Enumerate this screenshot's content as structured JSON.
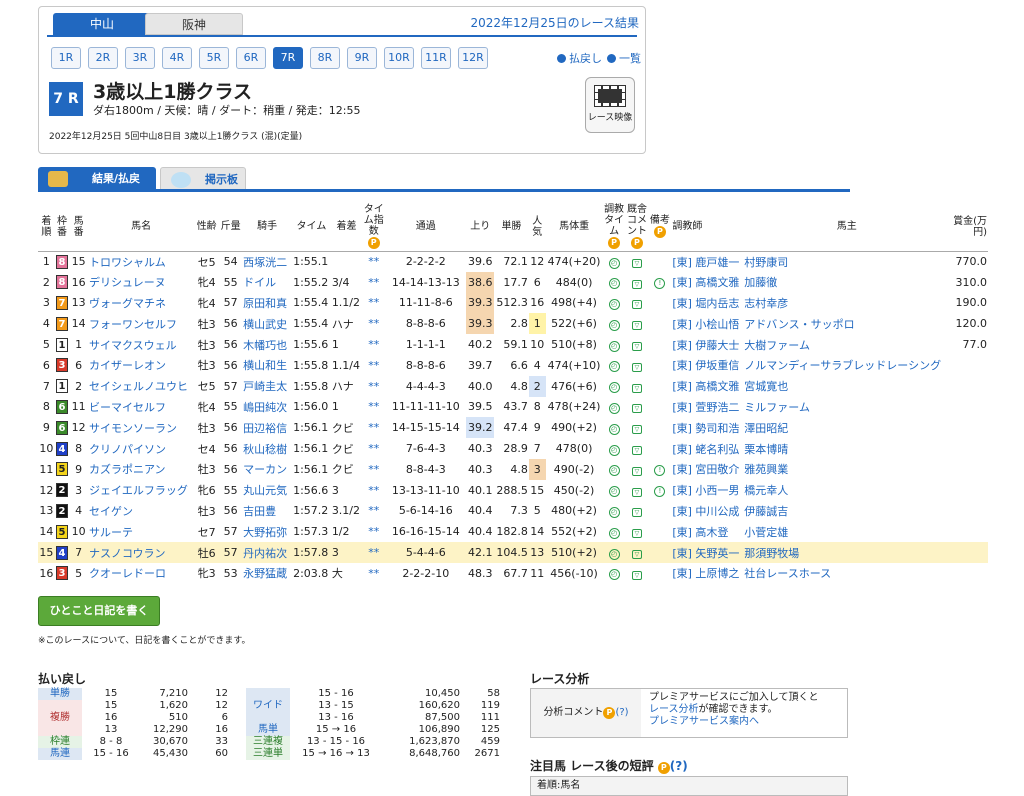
{
  "venue_tabs": [
    {
      "label": "中山",
      "active": true
    },
    {
      "label": "阪神",
      "active": false
    }
  ],
  "results_date_title": "2022年12月25日のレース結果",
  "race_buttons": [
    "1R",
    "2R",
    "3R",
    "4R",
    "5R",
    "6R",
    "7R",
    "8R",
    "9R",
    "10R",
    "11R",
    "12R"
  ],
  "active_race": "7R",
  "links": {
    "payback": "払戻し",
    "list": "一覧"
  },
  "race": {
    "number": "7 R",
    "title": "3歳以上1勝クラス",
    "conditions": "ダ右1800m / 天候：晴 / ダート：稍重 / 発走：12:55",
    "footer": "2022年12月25日 5回中山8日目 3歳以上1勝クラス (混)(定量)",
    "video": "レース映像"
  },
  "tabs": {
    "results": "結果/払戻",
    "board": "掲示板"
  },
  "headers": {
    "rank": "着順",
    "frame": "枠番",
    "num": "馬番",
    "name": "馬名",
    "sexage": "性齢",
    "weight": "斤量",
    "jockey": "騎手",
    "time": "タイム",
    "margin": "着差",
    "index": "タイム指数",
    "passing": "通過",
    "last3f": "上り",
    "odds": "単勝",
    "pop": "人気",
    "body": "馬体重",
    "train_time": "調教タイム",
    "stable_comment": "厩舎コメント",
    "remark": "備考",
    "trainer": "調教師",
    "owner": "馬主",
    "prize": "賞金(万円)"
  },
  "rows": [
    {
      "rank": "1",
      "frame": "8",
      "num": "15",
      "name": "トロワシャルム",
      "sexage": "セ5",
      "weight": "54",
      "jockey": "西塚洸二",
      "time": "1:55.1",
      "margin": "",
      "index": "**",
      "passing": "2-2-2-2",
      "last3f": "39.6",
      "odds": "72.1",
      "pop": "12",
      "body": "474(+20)",
      "remark": "",
      "trainer": "[東] 鹿戸雄一",
      "owner": "村野康司",
      "prize": "770.0"
    },
    {
      "rank": "2",
      "frame": "8",
      "num": "16",
      "name": "デリシュレーヌ",
      "sexage": "牝4",
      "weight": "55",
      "jockey": "ドイル",
      "time": "1:55.2",
      "margin": "3/4",
      "index": "**",
      "passing": "14-14-13-13",
      "last3f": "38.6",
      "odds": "17.7",
      "pop": "6",
      "body": "484(0)",
      "remark": "!",
      "trainer": "[東] 高橋文雅",
      "owner": "加藤徹",
      "prize": "310.0"
    },
    {
      "rank": "3",
      "frame": "7",
      "num": "13",
      "name": "ヴォーグマチネ",
      "sexage": "牝4",
      "weight": "57",
      "jockey": "原田和真",
      "time": "1:55.4",
      "margin": "1.1/2",
      "index": "**",
      "passing": "11-11-8-6",
      "last3f": "39.3",
      "odds": "512.3",
      "pop": "16",
      "body": "498(+4)",
      "remark": "",
      "trainer": "[東] 堀内岳志",
      "owner": "志村幸彦",
      "prize": "190.0"
    },
    {
      "rank": "4",
      "frame": "7",
      "num": "14",
      "name": "フォーワンセルフ",
      "sexage": "牡3",
      "weight": "56",
      "jockey": "横山武史",
      "time": "1:55.4",
      "margin": "ハナ",
      "index": "**",
      "passing": "8-8-8-6",
      "last3f": "39.3",
      "odds": "2.8",
      "pop": "1",
      "body": "522(+6)",
      "remark": "",
      "trainer": "[東] 小桧山悟",
      "owner": "アドバンス・サッポロ",
      "prize": "120.0"
    },
    {
      "rank": "5",
      "frame": "1",
      "num": "1",
      "name": "サイマクスウェル",
      "sexage": "牡3",
      "weight": "56",
      "jockey": "木幡巧也",
      "time": "1:55.6",
      "margin": "1",
      "index": "**",
      "passing": "1-1-1-1",
      "last3f": "40.2",
      "odds": "59.1",
      "pop": "10",
      "body": "510(+8)",
      "remark": "",
      "trainer": "[東] 伊藤大士",
      "owner": "大樹ファーム",
      "prize": "77.0"
    },
    {
      "rank": "6",
      "frame": "3",
      "num": "6",
      "name": "カイザーレオン",
      "sexage": "牡3",
      "weight": "56",
      "jockey": "横山和生",
      "time": "1:55.8",
      "margin": "1.1/4",
      "index": "**",
      "passing": "8-8-8-6",
      "last3f": "39.7",
      "odds": "6.6",
      "pop": "4",
      "body": "474(+10)",
      "remark": "",
      "trainer": "[東] 伊坂重信",
      "owner": "ノルマンディーサラブレッドレーシング",
      "prize": ""
    },
    {
      "rank": "7",
      "frame": "1",
      "num": "2",
      "name": "セイシェルノユウヒ",
      "sexage": "セ5",
      "weight": "57",
      "jockey": "戸崎圭太",
      "time": "1:55.8",
      "margin": "ハナ",
      "index": "**",
      "passing": "4-4-4-3",
      "last3f": "40.0",
      "odds": "4.8",
      "pop": "2",
      "body": "476(+6)",
      "remark": "",
      "trainer": "[東] 高橋文雅",
      "owner": "宮城寛也",
      "prize": ""
    },
    {
      "rank": "8",
      "frame": "6",
      "num": "11",
      "name": "ビーマイセルフ",
      "sexage": "牝4",
      "weight": "55",
      "jockey": "嶋田純次",
      "time": "1:56.0",
      "margin": "1",
      "index": "**",
      "passing": "11-11-11-10",
      "last3f": "39.5",
      "odds": "43.7",
      "pop": "8",
      "body": "478(+24)",
      "remark": "",
      "trainer": "[東] 萱野浩二",
      "owner": "ミルファーム",
      "prize": ""
    },
    {
      "rank": "9",
      "frame": "6",
      "num": "12",
      "name": "サイモンソーラン",
      "sexage": "牡3",
      "weight": "56",
      "jockey": "田辺裕信",
      "time": "1:56.1",
      "margin": "クビ",
      "index": "**",
      "passing": "14-15-15-14",
      "last3f": "39.2",
      "odds": "47.4",
      "pop": "9",
      "body": "490(+2)",
      "remark": "",
      "trainer": "[東] 勢司和浩",
      "owner": "澤田昭紀",
      "prize": ""
    },
    {
      "rank": "10",
      "frame": "4",
      "num": "8",
      "name": "クリノパイソン",
      "sexage": "セ4",
      "weight": "56",
      "jockey": "秋山稔樹",
      "time": "1:56.1",
      "margin": "クビ",
      "index": "**",
      "passing": "7-6-4-3",
      "last3f": "40.3",
      "odds": "28.9",
      "pop": "7",
      "body": "478(0)",
      "remark": "",
      "trainer": "[東] 蛯名利弘",
      "owner": "栗本博晴",
      "prize": ""
    },
    {
      "rank": "11",
      "frame": "5",
      "num": "9",
      "name": "カズラポニアン",
      "sexage": "牡3",
      "weight": "56",
      "jockey": "マーカン",
      "time": "1:56.1",
      "margin": "クビ",
      "index": "**",
      "passing": "8-8-4-3",
      "last3f": "40.3",
      "odds": "4.8",
      "pop": "3",
      "body": "490(-2)",
      "remark": "!",
      "trainer": "[東] 宮田敬介",
      "owner": "雅苑興業",
      "prize": ""
    },
    {
      "rank": "12",
      "frame": "2",
      "num": "3",
      "name": "ジェイエルフラッグ",
      "sexage": "牝6",
      "weight": "55",
      "jockey": "丸山元気",
      "time": "1:56.6",
      "margin": "3",
      "index": "**",
      "passing": "13-13-11-10",
      "last3f": "40.1",
      "odds": "288.5",
      "pop": "15",
      "body": "450(-2)",
      "remark": "!",
      "trainer": "[東] 小西一男",
      "owner": "橋元幸人",
      "prize": ""
    },
    {
      "rank": "13",
      "frame": "2",
      "num": "4",
      "name": "セイゲン",
      "sexage": "牡3",
      "weight": "56",
      "jockey": "吉田豊",
      "time": "1:57.2",
      "margin": "3.1/2",
      "index": "**",
      "passing": "5-6-14-16",
      "last3f": "40.4",
      "odds": "7.3",
      "pop": "5",
      "body": "480(+2)",
      "remark": "",
      "trainer": "[東] 中川公成",
      "owner": "伊藤誠吉",
      "prize": ""
    },
    {
      "rank": "14",
      "frame": "5",
      "num": "10",
      "name": "サルーテ",
      "sexage": "セ7",
      "weight": "57",
      "jockey": "大野拓弥",
      "time": "1:57.3",
      "margin": "1/2",
      "index": "**",
      "passing": "16-16-15-14",
      "last3f": "40.4",
      "odds": "182.8",
      "pop": "14",
      "body": "552(+2)",
      "remark": "",
      "trainer": "[東] 高木登",
      "owner": "小菅定雄",
      "prize": ""
    },
    {
      "rank": "15",
      "frame": "4",
      "num": "7",
      "name": "ナスノコウラン",
      "sexage": "牡6",
      "weight": "57",
      "jockey": "丹内祐次",
      "time": "1:57.8",
      "margin": "3",
      "index": "**",
      "passing": "5-4-4-6",
      "last3f": "42.1",
      "odds": "104.5",
      "pop": "13",
      "body": "510(+2)",
      "remark": "",
      "trainer": "[東] 矢野英一",
      "owner": "那須野牧場",
      "prize": ""
    },
    {
      "rank": "16",
      "frame": "3",
      "num": "5",
      "name": "クオーレドーロ",
      "sexage": "牝3",
      "weight": "53",
      "jockey": "永野猛蔵",
      "time": "2:03.8",
      "margin": "大",
      "index": "**",
      "passing": "2-2-2-10",
      "last3f": "48.3",
      "odds": "67.7",
      "pop": "11",
      "body": "456(-10)",
      "remark": "",
      "trainer": "[東] 上原博之",
      "owner": "社台レースホース",
      "prize": ""
    }
  ],
  "diary": {
    "button": "ひとこと日記を書く",
    "note": "※このレースについて、日記を書くことができます。"
  },
  "payout": {
    "title": "払い戻し",
    "left": [
      {
        "label": "単勝",
        "lines": [
          [
            "15",
            "7,210",
            "12"
          ]
        ]
      },
      {
        "label": "複勝",
        "lines": [
          [
            "15",
            "1,620",
            "12"
          ],
          [
            "16",
            "510",
            "6"
          ],
          [
            "13",
            "12,290",
            "16"
          ]
        ]
      },
      {
        "label": "枠連",
        "lines": [
          [
            "8 - 8",
            "30,670",
            "33"
          ]
        ]
      },
      {
        "label": "馬連",
        "lines": [
          [
            "15 - 16",
            "45,430",
            "60"
          ]
        ]
      }
    ],
    "right": [
      {
        "label": "ワイド",
        "lines": [
          [
            "15 - 16",
            "10,450",
            "58"
          ],
          [
            "13 - 15",
            "160,620",
            "119"
          ],
          [
            "13 - 16",
            "87,500",
            "111"
          ]
        ]
      },
      {
        "label": "馬単",
        "lines": [
          [
            "15 → 16",
            "106,890",
            "125"
          ]
        ]
      },
      {
        "label": "三連複",
        "lines": [
          [
            "13 - 15 - 16",
            "1,623,870",
            "459"
          ]
        ]
      },
      {
        "label": "三連単",
        "lines": [
          [
            "15 → 16 → 13",
            "8,648,760",
            "2671"
          ]
        ]
      }
    ]
  },
  "analysis": {
    "title": "レース分析",
    "label": "分析コメント",
    "help": "(?)",
    "line1": "プレミアサービスにご加入して頂くと",
    "line2": "レース分析",
    "line2b": "が確認できます。",
    "line3": "プレミアサービス案内へ"
  },
  "notes": {
    "title": "注目馬 レース後の短評",
    "help": "(?)",
    "head": "着順:馬名"
  },
  "colors": {
    "accent": "#2168c0",
    "frame1": "#ffffff",
    "frame2": "#111111",
    "frame3": "#d83a2a",
    "frame4": "#2040c8",
    "frame5": "#f4d41a",
    "frame6": "#3a8a2a",
    "frame7": "#f39a1a",
    "frame8": "#e3749a"
  }
}
